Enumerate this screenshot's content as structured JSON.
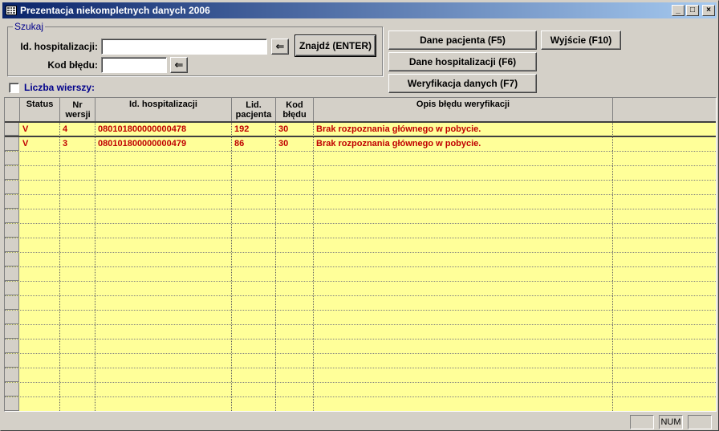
{
  "window": {
    "title": "Prezentacja niekompletnych danych 2006",
    "controls": {
      "minimize": "_",
      "maximize": "□",
      "close": "×"
    }
  },
  "search": {
    "legend": "Szukaj",
    "id_label": "Id. hospitalizacji:",
    "id_value": "",
    "kod_label": "Kod błędu:",
    "kod_value": "",
    "arrow_glyph": "⇐",
    "find_button": "Znajdź (ENTER)"
  },
  "actions": {
    "patient": "Dane pacjenta (F5)",
    "hospitalization": "Dane hospitalizacji (F6)",
    "verification": "Weryfikacja danych (F7)",
    "exit": "Wyjście (F10)"
  },
  "row_count": {
    "label": "Liczba wierszy:",
    "checked": false
  },
  "grid": {
    "columns": [
      {
        "key": "status",
        "label": "Status"
      },
      {
        "key": "nr",
        "label": "Nr wersji"
      },
      {
        "key": "id",
        "label": "Id. hospitalizacji"
      },
      {
        "key": "lid",
        "label": "Lid. pacjenta"
      },
      {
        "key": "kod",
        "label": "Kod błędu"
      },
      {
        "key": "opis",
        "label": "Opis błędu weryfikacji"
      }
    ],
    "rows": [
      {
        "status": "V",
        "nr": "4",
        "id": "080101800000000478",
        "lid": "192",
        "kod": "30",
        "opis": "Brak rozpoznania głównego w pobycie."
      },
      {
        "status": "V",
        "nr": "3",
        "id": "080101800000000479",
        "lid": "86",
        "kod": "30",
        "opis": "Brak rozpoznania głównego w pobycie."
      }
    ],
    "empty_rows": 18
  },
  "statusbar": {
    "num": "NUM"
  },
  "colors": {
    "grid_bg": "#ffff99",
    "data_text": "#c00000",
    "title_start": "#0a246a",
    "title_end": "#a6caf0"
  }
}
